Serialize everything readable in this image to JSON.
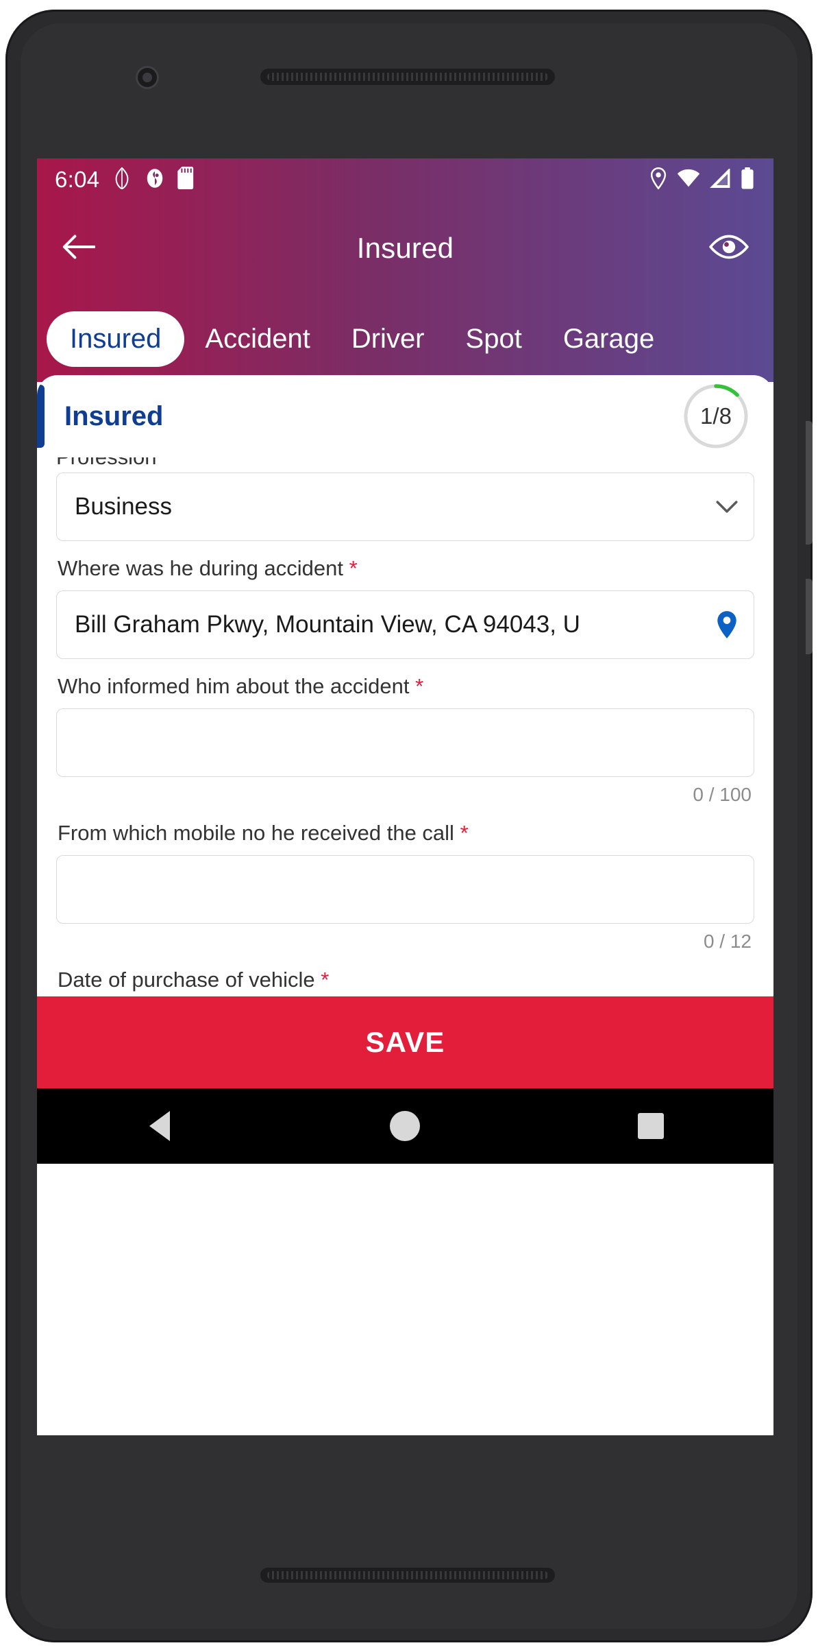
{
  "status_bar": {
    "time": "6:04",
    "left_icons": [
      "leaf-icon",
      "do-not-disturb-icon",
      "sd-card-icon"
    ],
    "right_icons": [
      "location-icon",
      "wifi-icon",
      "cellular-signal-icon",
      "battery-icon"
    ]
  },
  "app_bar": {
    "back_icon": "arrow-left-icon",
    "title": "Insured",
    "action_icon": "eye-icon"
  },
  "tabs": [
    {
      "label": "Insured",
      "active": true
    },
    {
      "label": "Accident",
      "active": false
    },
    {
      "label": "Driver",
      "active": false
    },
    {
      "label": "Spot",
      "active": false
    },
    {
      "label": "Garage",
      "active": false
    }
  ],
  "section": {
    "title": "Insured",
    "progress_current": "1",
    "progress_total": "8",
    "progress_separator": "/"
  },
  "form": {
    "fields": [
      {
        "label": "Profession",
        "required": false,
        "value": "Business",
        "type": "dropdown",
        "trailing_icon": "chevron-down-icon",
        "counter": null,
        "clipped": true
      },
      {
        "label": "Where was he during accident",
        "required": true,
        "value": "Bill Graham Pkwy, Mountain View, CA 94043, U",
        "type": "location",
        "trailing_icon": "map-pin-icon",
        "counter": null,
        "clipped": false
      },
      {
        "label": "Who informed him about the accident",
        "required": true,
        "value": "",
        "type": "text",
        "trailing_icon": null,
        "counter": "0 / 100",
        "clipped": false
      },
      {
        "label": "From which mobile no he received the call",
        "required": true,
        "value": "",
        "type": "tel",
        "trailing_icon": null,
        "counter": "0 / 12",
        "clipped": false
      },
      {
        "label": "Date of purchase of vehicle",
        "required": true,
        "value": "",
        "type": "date",
        "trailing_icon": "calendar-icon",
        "counter": null,
        "clipped": false
      }
    ],
    "required_marker": "*"
  },
  "save_button": {
    "label": "SAVE"
  },
  "nav_bar": {
    "back": "nav-back-icon",
    "home": "nav-home-icon",
    "recents": "nav-recents-icon"
  },
  "colors": {
    "header_gradient_start": "#a8174a",
    "header_gradient_mid": "#7b2d66",
    "header_gradient_end": "#5b4a93",
    "accent_blue": "#0f3d91",
    "save_red": "#e31e3a",
    "progress_green": "#35c23a",
    "required_red": "#e31e3a"
  }
}
